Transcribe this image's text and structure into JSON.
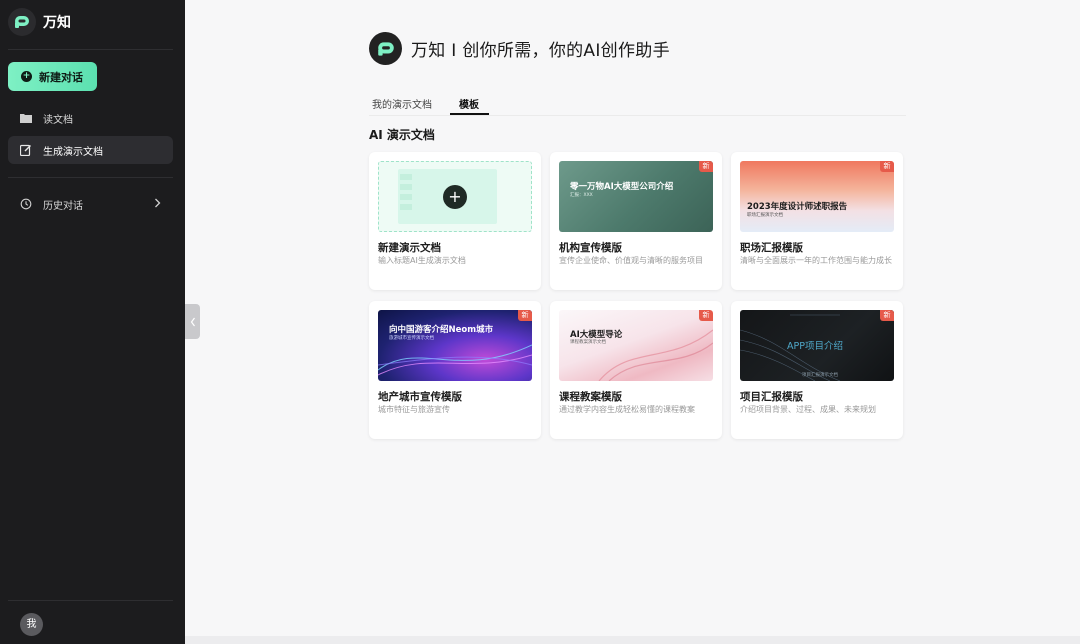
{
  "sidebar": {
    "brand": "万知",
    "new_chat": "新建对话",
    "items": [
      {
        "label": "读文档",
        "icon": "folder-icon"
      },
      {
        "label": "生成演示文档",
        "icon": "edit-document-icon"
      },
      {
        "label": "历史对话",
        "icon": "history-icon"
      }
    ],
    "avatar": "我"
  },
  "header": {
    "title": "万知 I 创你所需，你的AI创作助手"
  },
  "tabs": [
    {
      "label": "我的演示文档",
      "active": false
    },
    {
      "label": "模板",
      "active": true
    }
  ],
  "section_title": "AI 演示文档",
  "cards": [
    {
      "title": "新建演示文档",
      "desc": "输入标题AI生成演示文档",
      "badge": ""
    },
    {
      "title": "机构宣传模版",
      "desc": "宣传企业使命、价值观与清晰的服务项目",
      "badge": "新",
      "thumb_title": "零一万物AI大模型公司介绍",
      "thumb_sub": "汇报：XXX"
    },
    {
      "title": "职场汇报模版",
      "desc": "清晰与全面展示一年的工作范围与能力成长",
      "badge": "新",
      "thumb_title": "2023年度设计师述职报告",
      "thumb_sub": "职场汇报演示文档"
    },
    {
      "title": "地产城市宣传模版",
      "desc": "城市特征与旅游宣传",
      "badge": "新",
      "thumb_title": "向中国游客介绍Neom城市",
      "thumb_sub": "旅游城市宣传演示文档"
    },
    {
      "title": "课程教案模版",
      "desc": "通过教学内容生成轻松易懂的课程教案",
      "badge": "新",
      "thumb_title": "AI大模型导论",
      "thumb_sub": "课程教案演示文档"
    },
    {
      "title": "项目汇报模版",
      "desc": "介绍项目背景、过程、成果、未来规划",
      "badge": "新",
      "thumb_title": "APP项目介绍",
      "thumb_sub": "项目汇报演示文档"
    }
  ],
  "colors": {
    "accent": "#5be0b0",
    "sidebar_bg": "#1c1c1e",
    "badge": "#e65a4a"
  }
}
